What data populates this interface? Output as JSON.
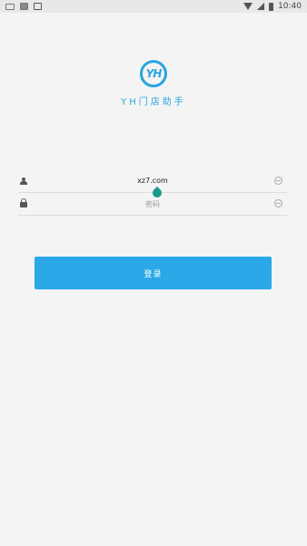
{
  "status_bar": {
    "time": "10:40",
    "left_icons": [
      "keyboard-icon",
      "photo-icon",
      "download-icon"
    ],
    "right_icons": [
      "wifi-icon",
      "signal-icon",
      "battery-icon"
    ]
  },
  "logo": {
    "mark": "YH",
    "title": "YH门店助手",
    "color": "#2aa5e0"
  },
  "form": {
    "username": {
      "value": "xz7.com",
      "icon": "user-icon"
    },
    "password": {
      "placeholder": "密码",
      "icon": "lock-icon"
    }
  },
  "login_button": {
    "label": "登录",
    "color": "#2aa8e8"
  }
}
